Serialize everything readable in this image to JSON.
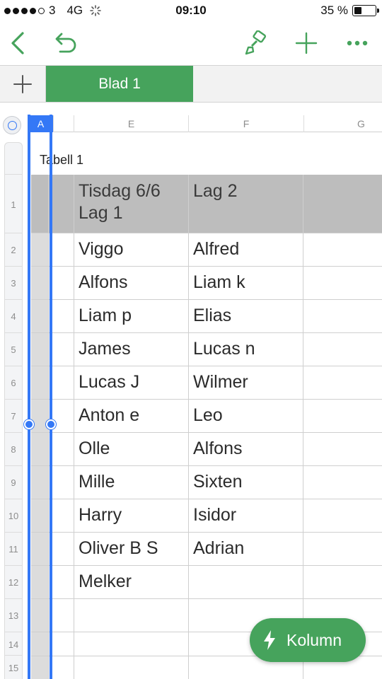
{
  "status_bar": {
    "carrier": "3",
    "network": "4G",
    "time": "09:10",
    "battery": "35 %",
    "battery_level": 0.35,
    "signal_bars": 4
  },
  "toolbar": {
    "icons": [
      "back-icon",
      "undo-icon",
      "paintbrush-icon",
      "add-icon",
      "more-icon"
    ],
    "accent_color": "#46a35c"
  },
  "sheet_tabs": {
    "add_icon": "plus-icon",
    "tabs": [
      {
        "label": "Blad 1",
        "active": true
      }
    ]
  },
  "grid": {
    "column_headers": [
      "A",
      "E",
      "F",
      "G"
    ],
    "selected_column": "A",
    "row_numbers": [
      "1",
      "2",
      "3",
      "4",
      "5",
      "6",
      "7",
      "8",
      "9",
      "10",
      "11",
      "12",
      "13",
      "14",
      "15"
    ],
    "table_title": "Tabell 1",
    "header_row": {
      "e": "Tisdag 6/6\nLag 1",
      "f": "Lag 2"
    },
    "rows": [
      {
        "e": "Viggo",
        "f": "Alfred"
      },
      {
        "e": "Alfons",
        "f": "Liam k"
      },
      {
        "e": "Liam p",
        "f": "Elias"
      },
      {
        "e": "James",
        "f": "Lucas n"
      },
      {
        "e": "Lucas J",
        "f": "Wilmer"
      },
      {
        "e": "Anton e",
        "f": "Leo"
      },
      {
        "e": "Olle",
        "f": "Alfons"
      },
      {
        "e": "Mille",
        "f": "Sixten"
      },
      {
        "e": "Harry",
        "f": "Isidor"
      },
      {
        "e": "Oliver B S",
        "f": "Adrian"
      },
      {
        "e": "Melker",
        "f": ""
      },
      {
        "e": "",
        "f": ""
      },
      {
        "e": "",
        "f": ""
      },
      {
        "e": "",
        "f": ""
      }
    ],
    "selection_color": "#3478f6",
    "header_fill": "#bdbdbd"
  },
  "fab": {
    "label": "Kolumn",
    "icon": "bolt-icon"
  }
}
